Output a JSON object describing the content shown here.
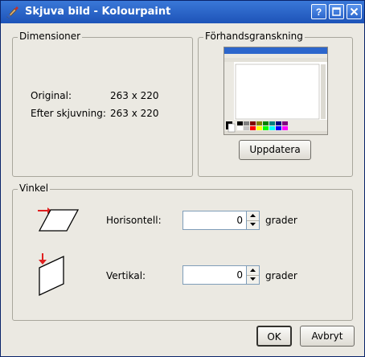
{
  "window": {
    "title": "Skjuva bild - Kolourpaint"
  },
  "dimensions": {
    "legend": "Dimensioner",
    "original_label": "Original:",
    "original_value": "263 x 220",
    "after_label": "Efter skjuvning:",
    "after_value": "263 x 220"
  },
  "preview": {
    "legend": "Förhandsgranskning",
    "update_button": "Uppdatera",
    "palette_colors": [
      "#000000",
      "#7f7f7f",
      "#7f0000",
      "#7f7f00",
      "#007f00",
      "#007f7f",
      "#00007f",
      "#7f007f",
      "#ffffff",
      "#c3c3c3",
      "#ff0000",
      "#ffff00",
      "#00ff00",
      "#00ffff",
      "#0000ff",
      "#ff00ff"
    ]
  },
  "angle": {
    "legend": "Vinkel",
    "horizontal_label": "Horisontell:",
    "horizontal_value": "0",
    "horizontal_unit": "grader",
    "vertical_label": "Vertikal:",
    "vertical_value": "0",
    "vertical_unit": "grader"
  },
  "buttons": {
    "ok": "OK",
    "cancel": "Avbryt"
  },
  "colors": {
    "titlebar": "#2c66cc",
    "arrow": "#e02020"
  }
}
